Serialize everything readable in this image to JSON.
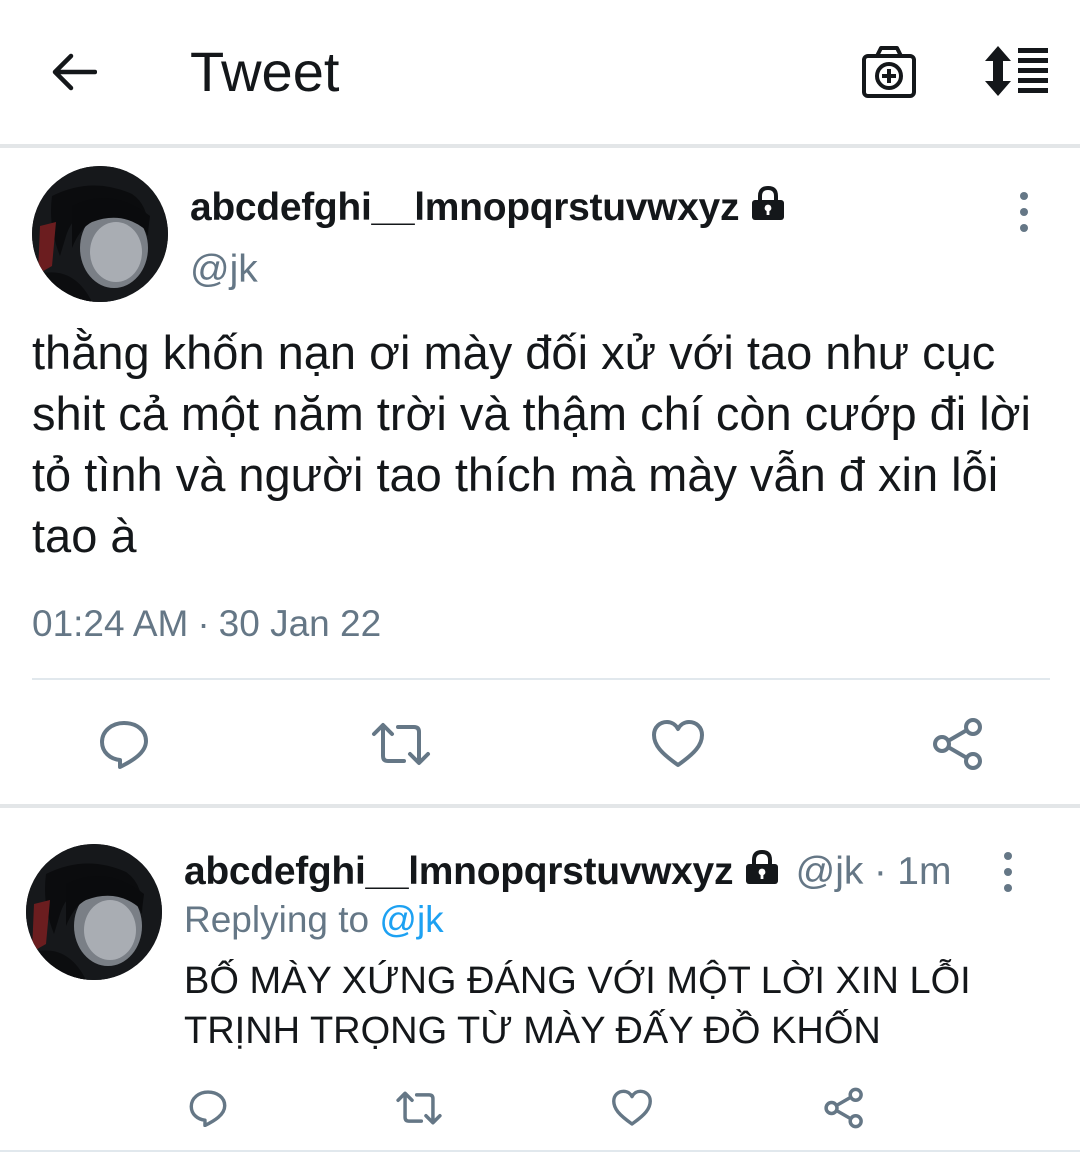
{
  "header": {
    "title": "Tweet",
    "back_icon": "arrow-left-icon",
    "camera_icon": "camera-plus-icon",
    "sort_icon": "sort-lines-icon"
  },
  "tweet": {
    "display_name": "abcdefghi__lmnopqrstuvwxyz",
    "handle": "@jk",
    "text": "thằng khốn nạn ơi mày đối xử với tao như cục shit cả một năm trời và thậm chí còn cướp đi lời tỏ tình và người tao thích mà mày vẫn đ xin lỗi tao à",
    "time": "01:24 AM",
    "separator": "·",
    "date": "30 Jan 22",
    "actions": [
      "reply-icon",
      "retweet-icon",
      "like-icon",
      "share-icon"
    ]
  },
  "reply": {
    "display_name": "abcdefghi__lmnopqrstuvwxyz",
    "handle": "@jk",
    "separator": "·",
    "age": "1m",
    "replying_label": "Replying to",
    "replying_handle": "@jk",
    "text": "BỐ MÀY XỨNG ĐÁNG VỚI MỘT LỜI XIN LỖI TRỊNH TRỌNG TỪ MÀY ĐẤY ĐỒ KHỐN",
    "actions": [
      "reply-icon",
      "retweet-icon",
      "like-icon",
      "share-icon"
    ]
  },
  "colors": {
    "text": "#14171a",
    "secondary": "#657786",
    "link": "#1da1f2",
    "divider": "#e1e8ed"
  }
}
